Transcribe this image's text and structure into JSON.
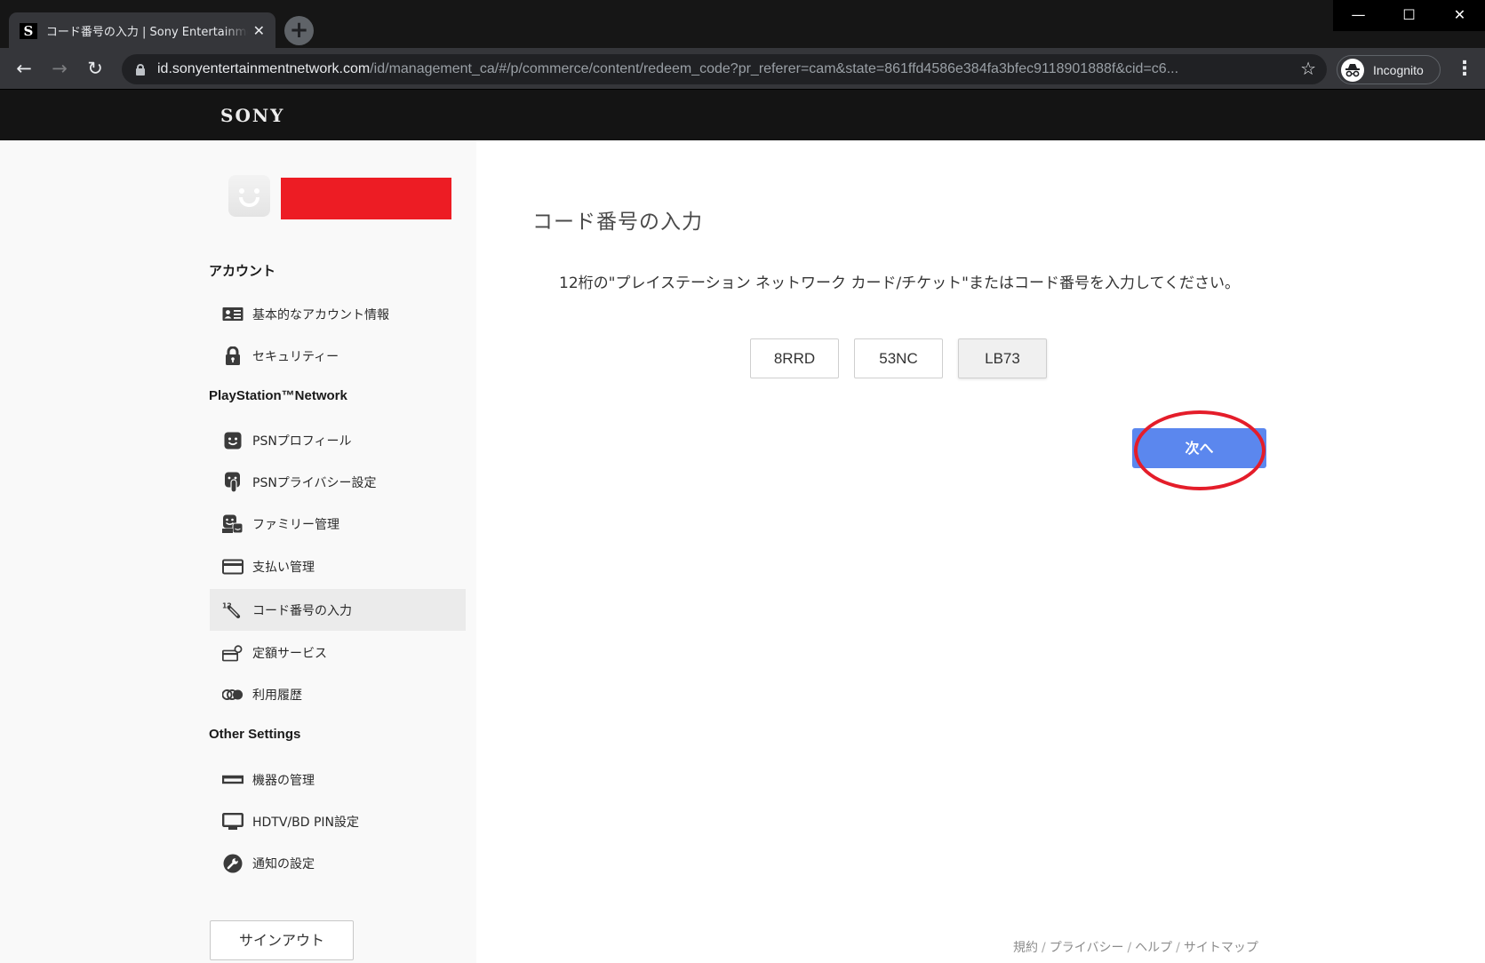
{
  "browser": {
    "tab": {
      "favicon_letter": "S",
      "title": "コード番号の入力 | Sony Entertainment Network",
      "close_glyph": "✕"
    },
    "new_tab_glyph": "+",
    "window_controls": {
      "minimize": "—",
      "maximize": "☐",
      "close": "✕"
    },
    "nav": {
      "back": "←",
      "forward": "→",
      "reload": "↻"
    },
    "url_host": "id.sonyentertainmentnetwork.com",
    "url_path": "/id/management_ca/#/p/commerce/content/redeem_code?pr_referer=cam&state=861ffd4586e384fa3bfec9118901888f&cid=c6...",
    "bookmark_glyph": "☆",
    "incognito_label": "Incognito",
    "menu_glyph": "⋮"
  },
  "site_header": {
    "logo": "SONY"
  },
  "sidebar": {
    "sections": [
      {
        "heading": "アカウント",
        "items": [
          {
            "label": "基本的なアカウント情報",
            "icon": "id-card-icon"
          },
          {
            "label": "セキュリティー",
            "icon": "lock-icon"
          }
        ]
      },
      {
        "heading": "PlayStation™Network",
        "items": [
          {
            "label": "PSNプロフィール",
            "icon": "smiley-face-icon"
          },
          {
            "label": "PSNプライバシー設定",
            "icon": "privacy-hand-icon"
          },
          {
            "label": "ファミリー管理",
            "icon": "family-icon"
          },
          {
            "label": "支払い管理",
            "icon": "credit-card-icon"
          },
          {
            "label": "コード番号の入力",
            "icon": "code-entry-icon",
            "active": true
          },
          {
            "label": "定額サービス",
            "icon": "subscription-icon"
          },
          {
            "label": "利用履歴",
            "icon": "history-icon"
          }
        ]
      },
      {
        "heading": "Other Settings",
        "items": [
          {
            "label": "機器の管理",
            "icon": "device-icon"
          },
          {
            "label": "HDTV/BD PIN設定",
            "icon": "monitor-icon"
          },
          {
            "label": "通知の設定",
            "icon": "wrench-icon"
          }
        ]
      }
    ],
    "signout_label": "サインアウト"
  },
  "main": {
    "title": "コード番号の入力",
    "description": "12桁の\"プレイステーション ネットワーク カード/チケット\"またはコード番号を入力してください。",
    "code_fields": [
      "8RRD",
      "53NC",
      "LB73"
    ],
    "next_label": "次へ",
    "annotation_color": "#e41d2a",
    "accent_color": "#5b87ee"
  },
  "footer": {
    "links": [
      "規約",
      "プライバシー",
      "ヘルプ",
      "サイトマップ"
    ],
    "separator": "/"
  }
}
